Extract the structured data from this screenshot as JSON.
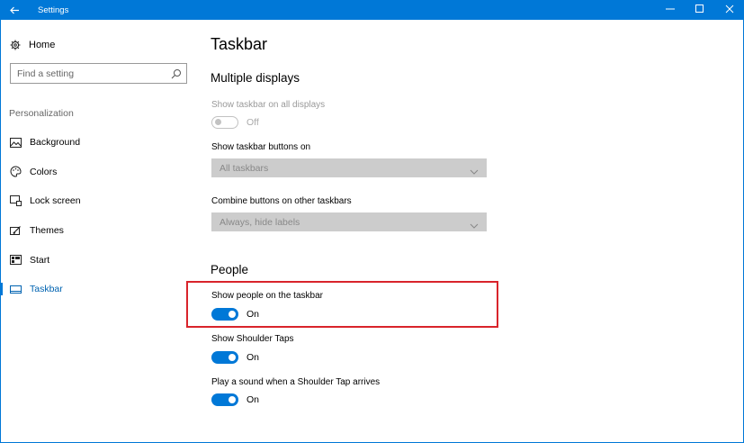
{
  "window": {
    "title": "Settings",
    "accent_color": "#0078d7",
    "controls": {
      "minimize": "—",
      "maximize": "☐",
      "close": "✕"
    }
  },
  "sidebar": {
    "home_label": "Home",
    "search_placeholder": "Find a setting",
    "section_header": "Personalization",
    "items": [
      {
        "label": "Background",
        "icon": "picture-icon",
        "active": false
      },
      {
        "label": "Colors",
        "icon": "palette-icon",
        "active": false
      },
      {
        "label": "Lock screen",
        "icon": "lock-screen-icon",
        "active": false
      },
      {
        "label": "Themes",
        "icon": "themes-icon",
        "active": false
      },
      {
        "label": "Start",
        "icon": "start-icon",
        "active": false
      },
      {
        "label": "Taskbar",
        "icon": "taskbar-icon",
        "active": true
      }
    ]
  },
  "main": {
    "page_title": "Taskbar",
    "multiple_displays": {
      "title": "Multiple displays",
      "show_taskbar_all": {
        "label": "Show taskbar on all displays",
        "state": "Off",
        "enabled": false
      },
      "show_buttons_on": {
        "label": "Show taskbar buttons on",
        "value": "All taskbars",
        "enabled": false
      },
      "combine_buttons": {
        "label": "Combine buttons on other taskbars",
        "value": "Always, hide labels",
        "enabled": false
      }
    },
    "people": {
      "title": "People",
      "show_people": {
        "label": "Show people on the taskbar",
        "state": "On"
      },
      "shoulder_taps": {
        "label": "Show Shoulder Taps",
        "state": "On"
      },
      "play_sound": {
        "label": "Play a sound when a Shoulder Tap arrives",
        "state": "On"
      }
    }
  },
  "annotation": {
    "highlight_color": "#d9242b"
  }
}
